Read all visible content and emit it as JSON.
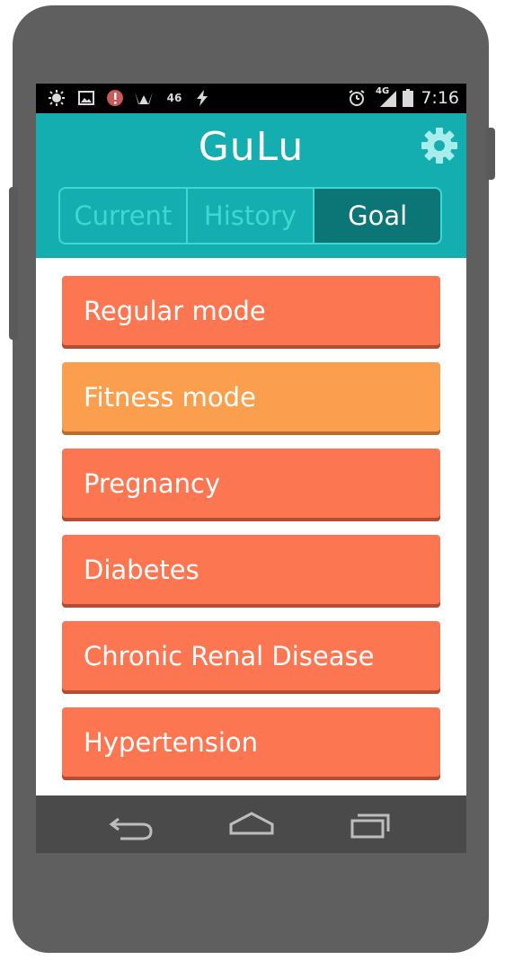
{
  "statusbar": {
    "network_label": "46",
    "signal_label": "4G",
    "time": "7:16"
  },
  "app": {
    "title": "GuLu"
  },
  "tabs": [
    {
      "label": "Current",
      "active": false
    },
    {
      "label": "History",
      "active": false
    },
    {
      "label": "Goal",
      "active": true
    }
  ],
  "modes": [
    {
      "label": "Regular mode",
      "color": "#fb7651"
    },
    {
      "label": "Fitness mode",
      "color": "#fb9f4e"
    },
    {
      "label": "Pregnancy",
      "color": "#fb7651"
    },
    {
      "label": "Diabetes",
      "color": "#fb7651"
    },
    {
      "label": "Chronic Renal Disease",
      "color": "#fb7651"
    },
    {
      "label": "Hypertension",
      "color": "#fb7651"
    }
  ],
  "colors": {
    "appbar": "#14aeb0",
    "tab_border": "#3fd7d3",
    "tab_active": "#0c7676",
    "phone_body": "#5f5f5f",
    "navbar": "#4a4a4a"
  },
  "icons": {
    "settings": "gear-icon",
    "back": "back-icon",
    "home": "home-icon",
    "recents": "recents-icon"
  }
}
